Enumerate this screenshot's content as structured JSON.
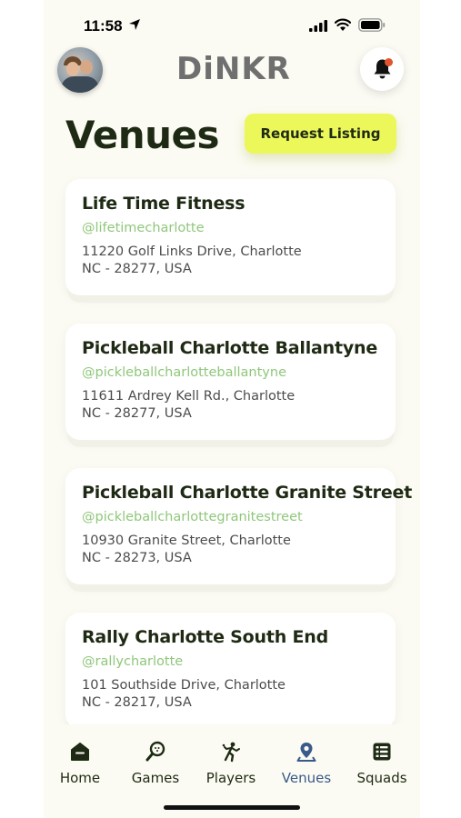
{
  "status_bar": {
    "time": "11:58"
  },
  "header": {
    "logo": "DiNKR"
  },
  "page": {
    "title": "Venues",
    "request_button": "Request Listing"
  },
  "venues": [
    {
      "name": "Life Time Fitness",
      "handle": "@lifetimecharlotte",
      "address_line1": "11220 Golf Links Drive, Charlotte",
      "address_line2": "NC - 28277, USA"
    },
    {
      "name": "Pickleball Charlotte Ballantyne",
      "handle": "@pickleballcharlotteballantyne",
      "address_line1": "11611 Ardrey Kell Rd., Charlotte",
      "address_line2": "NC - 28277, USA"
    },
    {
      "name": "Pickleball Charlotte Granite Street",
      "handle": "@pickleballcharlottegranitestreet",
      "address_line1": "10930 Granite Street, Charlotte",
      "address_line2": "NC - 28273, USA"
    },
    {
      "name": "Rally Charlotte South End",
      "handle": "@rallycharlotte",
      "address_line1": "101 Southside Drive, Charlotte",
      "address_line2": "NC - 28217, USA"
    }
  ],
  "tabs": [
    {
      "label": "Home",
      "icon": "home-icon",
      "active": false
    },
    {
      "label": "Games",
      "icon": "paddle-icon",
      "active": false
    },
    {
      "label": "Players",
      "icon": "player-icon",
      "active": false
    },
    {
      "label": "Venues",
      "icon": "location-pin-icon",
      "active": true
    },
    {
      "label": "Squads",
      "icon": "list-icon",
      "active": false
    }
  ],
  "colors": {
    "accent": "#ecf75a",
    "handle": "#8fc77a",
    "title": "#1f2a14",
    "active_tab": "#3a5a8a",
    "notification_dot": "#e2542f",
    "background": "#fbfbf3"
  }
}
